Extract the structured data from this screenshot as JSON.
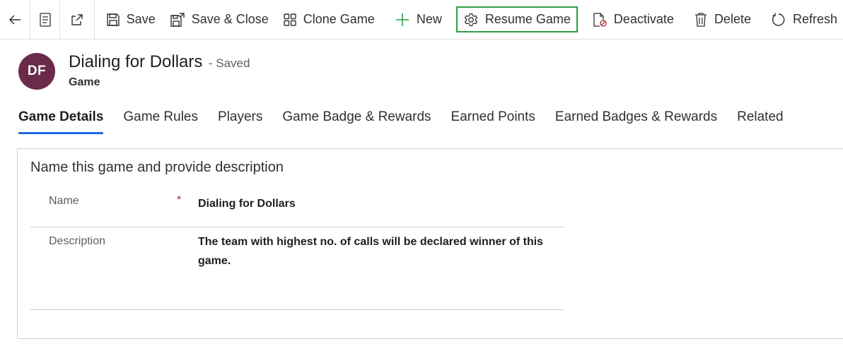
{
  "toolbar": {
    "back_icon": "back-arrow-icon",
    "form_icon": "form-icon",
    "popout_icon": "popout-icon",
    "commands": [
      {
        "label": "Save",
        "icon": "save-icon"
      },
      {
        "label": "Save & Close",
        "icon": "save-close-icon"
      },
      {
        "label": "Clone Game",
        "icon": "clone-icon"
      },
      {
        "label": "New",
        "icon": "plus-icon"
      },
      {
        "label": "Resume Game",
        "icon": "gear-icon",
        "highlight_color": "#2e9e45"
      },
      {
        "label": "Deactivate",
        "icon": "deactivate-icon"
      },
      {
        "label": "Delete",
        "icon": "trash-icon"
      },
      {
        "label": "Refresh",
        "icon": "refresh-icon"
      }
    ]
  },
  "record": {
    "initials": "DF",
    "avatar_color": "#6b2a4a",
    "title": "Dialing for Dollars",
    "status": "- Saved",
    "entity": "Game"
  },
  "tabs": [
    {
      "label": "Game Details",
      "active": true
    },
    {
      "label": "Game Rules"
    },
    {
      "label": "Players"
    },
    {
      "label": "Game Badge & Rewards"
    },
    {
      "label": "Earned Points"
    },
    {
      "label": "Earned Badges & Rewards"
    },
    {
      "label": "Related"
    }
  ],
  "accent_color": "#2266e3",
  "section": {
    "title": "Name this game and provide description",
    "fields": {
      "name": {
        "label": "Name",
        "required_marker": "*",
        "value": "Dialing for Dollars"
      },
      "description": {
        "label": "Description",
        "value": "The team with highest no. of calls will be declared winner of this game."
      }
    }
  }
}
